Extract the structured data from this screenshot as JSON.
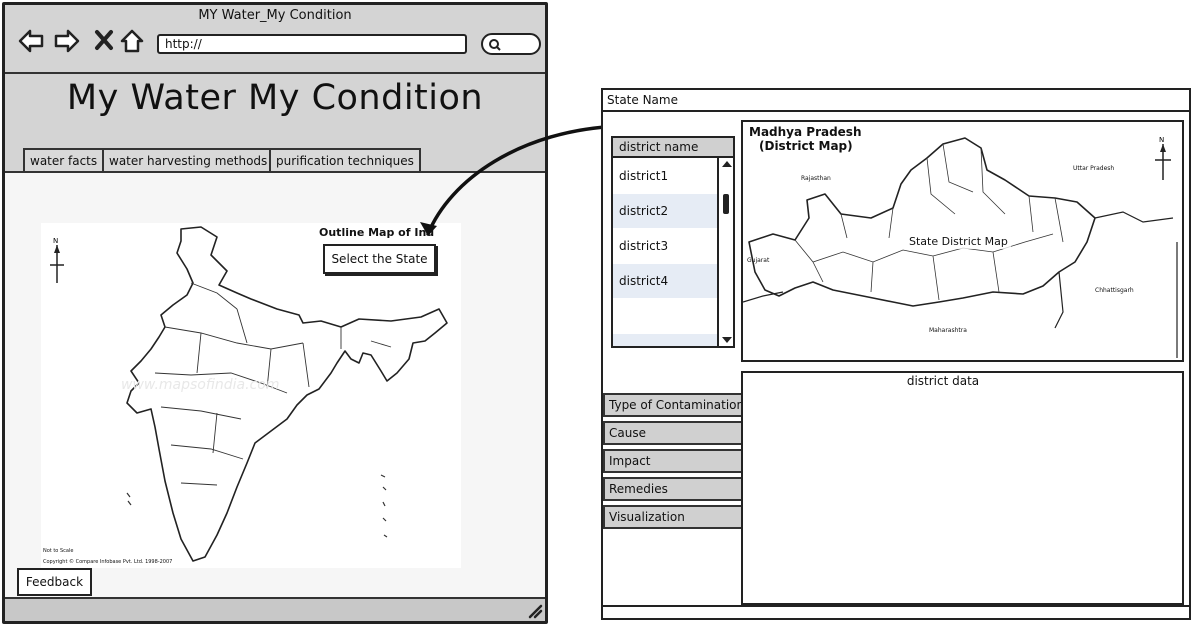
{
  "window": {
    "title": "MY Water_My Condition",
    "url": "http://"
  },
  "app": {
    "title": "My Water My Condition",
    "tabs": [
      {
        "label": "water facts"
      },
      {
        "label": "water harvesting methods"
      },
      {
        "label": "purification techniques"
      }
    ]
  },
  "india_map": {
    "title": "Outline Map of Ind",
    "compass": "N",
    "select_button": "Select the State",
    "footer_note": "Not to Scale",
    "copyright": "Copyright © Compare Infobase Pvt. Ltd. 1998-2007"
  },
  "feedback_button": "Feedback",
  "district_panel": {
    "state_name_label": "State Name",
    "list_header": "district name",
    "districts": [
      "district1",
      "district2",
      "district3",
      "district4"
    ],
    "map": {
      "title_line1": "Madhya Pradesh",
      "title_line2": "(District Map)",
      "placeholder": "State District Map",
      "compass": "N",
      "neighbors": [
        "Rajasthan",
        "Uttar Pradesh",
        "Gujarat",
        "Chhattisgarh",
        "Maharashtra"
      ]
    },
    "data_label": "district data",
    "menu": [
      "Type of Contamination",
      "Cause",
      "Impact",
      "Remedies",
      "Visualization"
    ]
  },
  "colors": {
    "chrome": "#d4d4d4",
    "border": "#222222",
    "selected_row": "#e6ecf5"
  }
}
